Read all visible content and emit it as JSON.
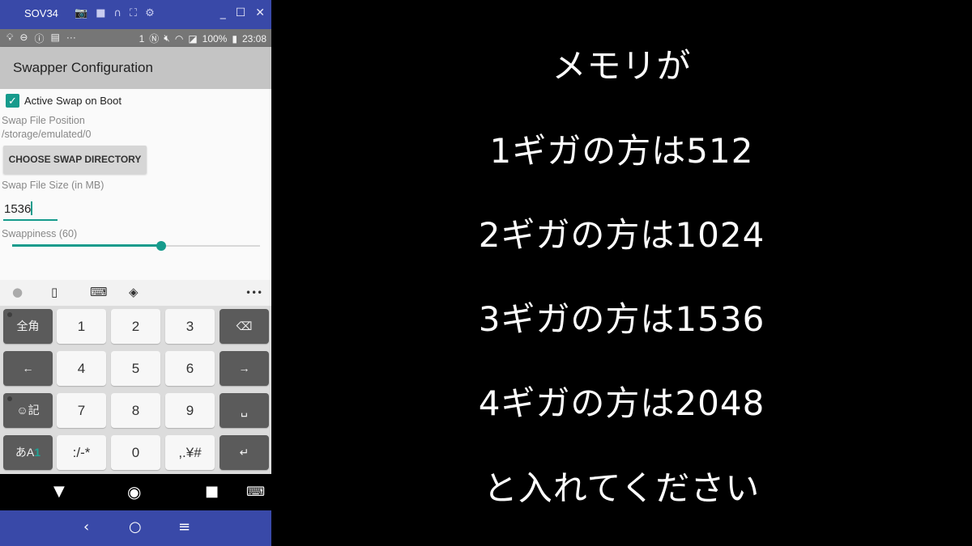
{
  "emulator": {
    "title": "SOV34",
    "tool_icons": [
      "camera-icon",
      "video-icon",
      "headset-icon",
      "fullscreen-icon",
      "settings-icon"
    ],
    "window_controls": {
      "minimize": "_",
      "maximize": "☐",
      "close": "✕"
    }
  },
  "status_bar": {
    "notification_count": "1",
    "battery": "100%",
    "time": "23:08"
  },
  "app": {
    "title": "Swapper Configuration",
    "active_swap_on_boot": {
      "label": "Active Swap on Boot",
      "checked": true
    },
    "swap_file_position": {
      "label": "Swap File Position",
      "value": "/storage/emulated/0"
    },
    "choose_button": "CHOOSE SWAP DIRECTORY",
    "swap_file_size": {
      "label": "Swap File Size (in MB)",
      "value": "1536"
    },
    "swappiness": {
      "label": "Swappiness (60)",
      "value": 60,
      "max": 100
    },
    "accent_color": "#169b8c"
  },
  "keyboard": {
    "toolbar": {
      "more": "•••"
    },
    "rows": [
      [
        "全角",
        "1",
        "2",
        "3",
        "⌫"
      ],
      [
        "←",
        "4",
        "5",
        "6",
        "→"
      ],
      [
        "☺記",
        "7",
        "8",
        "9",
        "␣"
      ],
      [
        "あA1",
        ":/-*",
        "0",
        ",.¥#",
        "↵"
      ]
    ]
  },
  "navigation": {
    "device": [
      "back-triangle",
      "home-circle",
      "recents-square",
      "keyboard-switch"
    ],
    "emulator": [
      "back",
      "home",
      "menu"
    ]
  },
  "instructions": {
    "lines": [
      "メモリが",
      "1ギガの方は512",
      "2ギガの方は1024",
      "3ギガの方は1536",
      "4ギガの方は2048",
      "と入れてください"
    ]
  }
}
